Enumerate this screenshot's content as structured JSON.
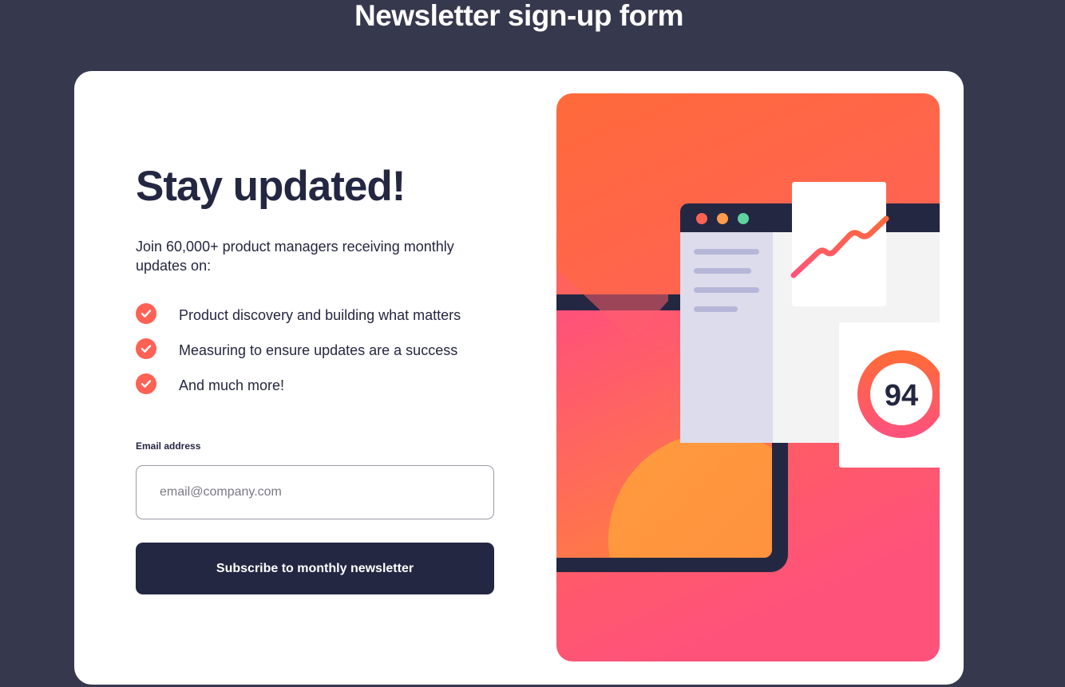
{
  "page": {
    "title": "Newsletter sign-up form"
  },
  "signup": {
    "headline": "Stay updated!",
    "intro": "Join 60,000+ product managers receiving monthly updates on:",
    "features": [
      "Product discovery and building what matters",
      "Measuring to ensure updates are a success",
      "And much more!"
    ],
    "email": {
      "label": "Email address",
      "placeholder": "email@company.com",
      "value": ""
    },
    "subscribe_label": "Subscribe to monthly newsletter"
  },
  "illustration": {
    "score": "94",
    "icons": [
      "check-icon",
      "window-dot-icon",
      "line-chart-icon",
      "score-ring-icon"
    ]
  },
  "colors": {
    "background": "#36384d",
    "card": "#ffffff",
    "dark_navy": "#242742",
    "tomato": "#ff6155",
    "gradient_top": "#ff6a3a",
    "gradient_bottom": "#ff527b"
  }
}
